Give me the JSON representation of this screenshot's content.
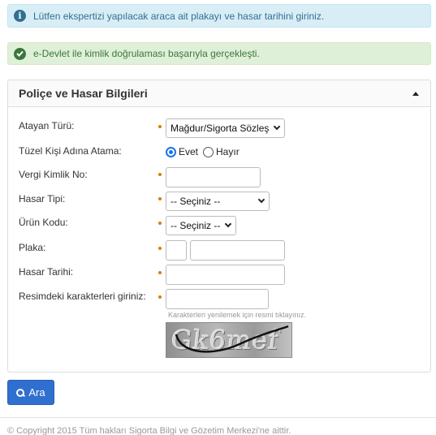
{
  "alerts": {
    "info_text": "Lütfen ekspertizi yapılacak araca ait plakayı ve hasar tarihini giriniz.",
    "success_text": "e-Devlet ile kimlik doğrulaması başarıyla gerçekleşti."
  },
  "panel": {
    "title": "Poliçe ve Hasar Bilgileri"
  },
  "form": {
    "atayan_turu": {
      "label": "Atayan Türü:",
      "value": "Mağdur/Sigorta Sözleş"
    },
    "tuzel_kisi": {
      "label": "Tüzel Kişi Adına Atama:",
      "options": [
        "Evet",
        "Hayır"
      ],
      "selected": "Evet"
    },
    "vergi_kimlik": {
      "label": "Vergi Kimlik No:",
      "value": ""
    },
    "hasar_tipi": {
      "label": "Hasar Tipi:",
      "value": "-- Seçiniz --"
    },
    "urun_kodu": {
      "label": "Ürün Kodu:",
      "value": "-- Seçiniz --"
    },
    "plaka": {
      "label": "Plaka:",
      "value_part1": "",
      "value_part2": ""
    },
    "hasar_tarihi": {
      "label": "Hasar Tarihi:",
      "value": ""
    },
    "captcha": {
      "label": "Resimdeki karakterleri giriniz:",
      "value": "",
      "hint": "Karakterleri yenilemek için resmi tıklayınız.",
      "image_text": "Gk6mef"
    }
  },
  "actions": {
    "search_label": "Ara"
  },
  "footer": {
    "text": "© Copyright 2015 Tüm hakları Sigorta Bilgi ve Gözetim Merkezi'ne aittir."
  },
  "colors": {
    "required_dot": "#e07b00",
    "primary_button": "#2f6fd0",
    "info_bg": "#d9edf7",
    "success_bg": "#dff0d8"
  }
}
